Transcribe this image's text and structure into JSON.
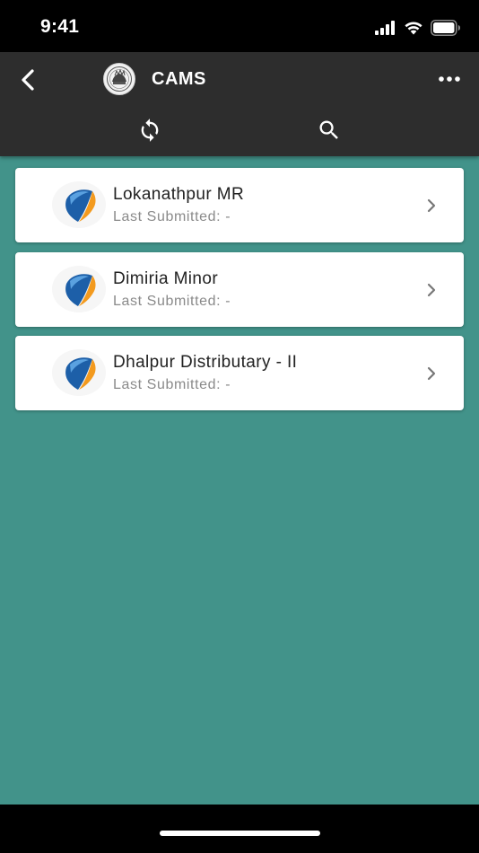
{
  "status_bar": {
    "time": "9:41"
  },
  "app_bar": {
    "title": "CAMS"
  },
  "canals": [
    {
      "name": "Lokanathpur MR",
      "subtitle": "Last Submitted: -"
    },
    {
      "name": "Dimiria Minor",
      "subtitle": "Last Submitted: -"
    },
    {
      "name": "Dhalpur Distributary - II",
      "subtitle": "Last Submitted: -"
    }
  ],
  "colors": {
    "app_bar": "#2d2d2d",
    "background": "#42938a",
    "card": "#ffffff",
    "logo_blue": "#1d5fa8",
    "logo_orange": "#f39a1e"
  },
  "icons": {
    "back": "chevron-left-icon",
    "emblem": "odisha-emblem-icon",
    "more": "more-horizontal-icon",
    "sync": "sync-icon",
    "search": "search-icon",
    "item_logo": "cams-logo-icon",
    "item_chevron": "chevron-right-icon"
  }
}
